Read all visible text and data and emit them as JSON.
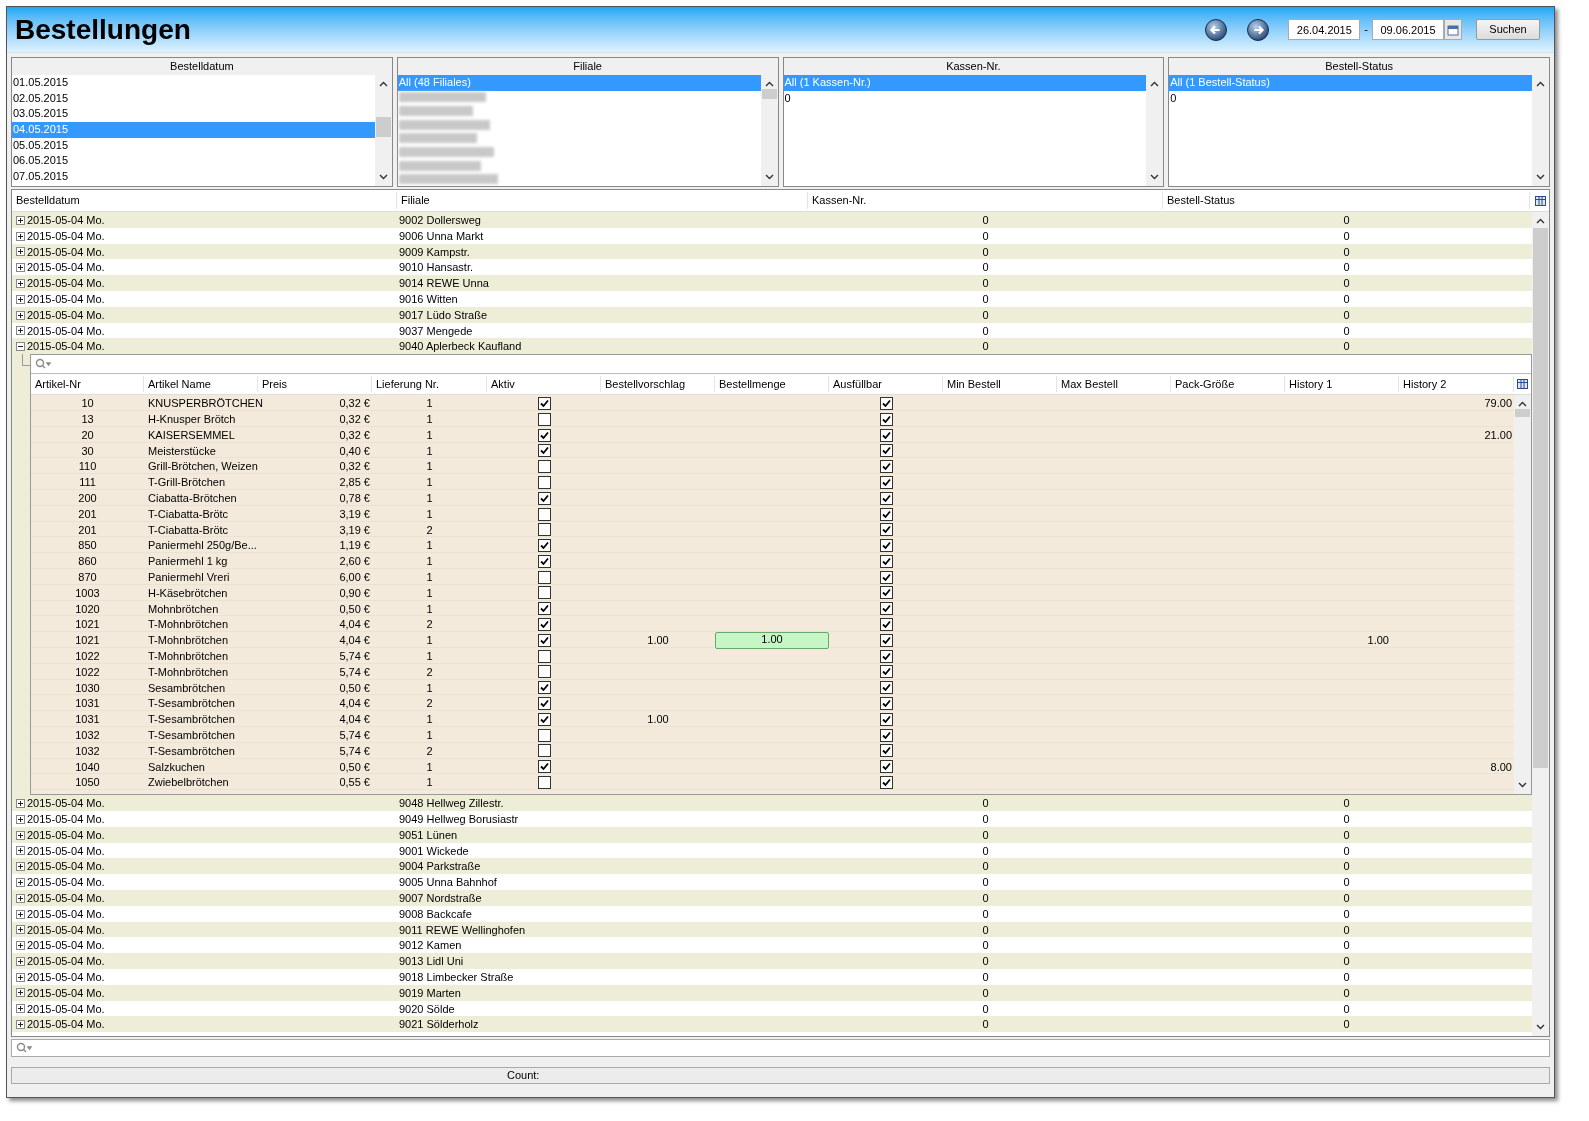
{
  "window": {
    "title": "Bestellungen"
  },
  "toolbar": {
    "date_from": "26.04.2015",
    "separator": "-",
    "date_to": "09.06.2015",
    "search_button": "Suchen"
  },
  "filters": [
    {
      "title": "Bestelldatum",
      "items": [
        {
          "kind": "text",
          "label": "01.05.2015",
          "selected": false
        },
        {
          "kind": "text",
          "label": "02.05.2015",
          "selected": false
        },
        {
          "kind": "text",
          "label": "03.05.2015",
          "selected": false
        },
        {
          "kind": "text",
          "label": "04.05.2015",
          "selected": true
        },
        {
          "kind": "text",
          "label": "05.05.2015",
          "selected": false
        },
        {
          "kind": "text",
          "label": "06.05.2015",
          "selected": false
        },
        {
          "kind": "text",
          "label": "07.05.2015",
          "selected": false
        }
      ]
    },
    {
      "title": "Filiale",
      "items": [
        {
          "kind": "text",
          "label": "All (48 Filiales)",
          "selected": true
        },
        {
          "kind": "blurred",
          "selected": false
        },
        {
          "kind": "blurred",
          "selected": false
        },
        {
          "kind": "blurred",
          "selected": false
        },
        {
          "kind": "blurred",
          "selected": false
        },
        {
          "kind": "blurred",
          "selected": false
        },
        {
          "kind": "blurred",
          "selected": false
        },
        {
          "kind": "blurred",
          "selected": false
        }
      ]
    },
    {
      "title": "Kassen-Nr.",
      "items": [
        {
          "kind": "text",
          "label": "All (1 Kassen-Nr.)",
          "selected": true
        },
        {
          "kind": "text",
          "label": "0",
          "selected": false
        }
      ]
    },
    {
      "title": "Bestell-Status",
      "items": [
        {
          "kind": "text",
          "label": "All (1 Bestell-Status)",
          "selected": true
        },
        {
          "kind": "text",
          "label": "0",
          "selected": false
        }
      ]
    }
  ],
  "grid": {
    "columns": [
      "Bestelldatum",
      "Filiale",
      "Kassen-Nr.",
      "Bestell-Status"
    ],
    "rows_before": [
      {
        "date": "2015-05-04 Mo.",
        "filiale": "9002 Dollersweg",
        "kasse": "0",
        "status": "0",
        "expanded": false
      },
      {
        "date": "2015-05-04 Mo.",
        "filiale": "9006 Unna Markt",
        "kasse": "0",
        "status": "0",
        "expanded": false
      },
      {
        "date": "2015-05-04 Mo.",
        "filiale": "9009 Kampstr.",
        "kasse": "0",
        "status": "0",
        "expanded": false
      },
      {
        "date": "2015-05-04 Mo.",
        "filiale": "9010 Hansastr.",
        "kasse": "0",
        "status": "0",
        "expanded": false
      },
      {
        "date": "2015-05-04 Mo.",
        "filiale": "9014 REWE Unna",
        "kasse": "0",
        "status": "0",
        "expanded": false
      },
      {
        "date": "2015-05-04 Mo.",
        "filiale": "9016 Witten",
        "kasse": "0",
        "status": "0",
        "expanded": false
      },
      {
        "date": "2015-05-04 Mo.",
        "filiale": "9017 Lüdo Straße",
        "kasse": "0",
        "status": "0",
        "expanded": false
      },
      {
        "date": "2015-05-04 Mo.",
        "filiale": "9037 Mengede",
        "kasse": "0",
        "status": "0",
        "expanded": false
      },
      {
        "date": "2015-05-04 Mo.",
        "filiale": "9040 Aplerbeck Kaufland",
        "kasse": "0",
        "status": "0",
        "expanded": true
      }
    ],
    "detail": {
      "columns": [
        "Artikel-Nr",
        "Artikel Name",
        "Preis",
        "Lieferung Nr.",
        "Aktiv",
        "Bestellvorschlag",
        "Bestellmenge",
        "Ausfüllbar",
        "Min Bestell",
        "Max Bestell",
        "Pack-Größe",
        "History 1",
        "History 2"
      ],
      "rows": [
        {
          "nr": "10",
          "name": "KNUSPERBRÖTCHEN",
          "preis": "0,32 €",
          "lieferung": "1",
          "aktiv": true,
          "vorschlag": "",
          "menge": "",
          "editing": false,
          "ausfuellbar": true,
          "history1": "",
          "history2": "79.00"
        },
        {
          "nr": "13",
          "name": "H-Knusper Brötch",
          "preis": "0,32 €",
          "lieferung": "1",
          "aktiv": false,
          "vorschlag": "",
          "menge": "",
          "editing": false,
          "ausfuellbar": true,
          "history1": "",
          "history2": ""
        },
        {
          "nr": "20",
          "name": "KAISERSEMMEL",
          "preis": "0,32 €",
          "lieferung": "1",
          "aktiv": true,
          "vorschlag": "",
          "menge": "",
          "editing": false,
          "ausfuellbar": true,
          "history1": "",
          "history2": "21.00"
        },
        {
          "nr": "30",
          "name": "Meisterstücke",
          "preis": "0,40 €",
          "lieferung": "1",
          "aktiv": true,
          "vorschlag": "",
          "menge": "",
          "editing": false,
          "ausfuellbar": true,
          "history1": "",
          "history2": ""
        },
        {
          "nr": "110",
          "name": "Grill-Brötchen, Weizen",
          "preis": "0,32 €",
          "lieferung": "1",
          "aktiv": false,
          "vorschlag": "",
          "menge": "",
          "editing": false,
          "ausfuellbar": true,
          "history1": "",
          "history2": ""
        },
        {
          "nr": "111",
          "name": "T-Grill-Brötchen",
          "preis": "2,85 €",
          "lieferung": "1",
          "aktiv": false,
          "vorschlag": "",
          "menge": "",
          "editing": false,
          "ausfuellbar": true,
          "history1": "",
          "history2": ""
        },
        {
          "nr": "200",
          "name": "Ciabatta-Brötchen",
          "preis": "0,78 €",
          "lieferung": "1",
          "aktiv": true,
          "vorschlag": "",
          "menge": "",
          "editing": false,
          "ausfuellbar": true,
          "history1": "",
          "history2": ""
        },
        {
          "nr": "201",
          "name": "T-Ciabatta-Brötc",
          "preis": "3,19 €",
          "lieferung": "1",
          "aktiv": false,
          "vorschlag": "",
          "menge": "",
          "editing": false,
          "ausfuellbar": true,
          "history1": "",
          "history2": ""
        },
        {
          "nr": "201",
          "name": "T-Ciabatta-Brötc",
          "preis": "3,19 €",
          "lieferung": "2",
          "aktiv": false,
          "vorschlag": "",
          "menge": "",
          "editing": false,
          "ausfuellbar": true,
          "history1": "",
          "history2": ""
        },
        {
          "nr": "850",
          "name": "Paniermehl 250g/Be...",
          "preis": "1,19 €",
          "lieferung": "1",
          "aktiv": true,
          "vorschlag": "",
          "menge": "",
          "editing": false,
          "ausfuellbar": true,
          "history1": "",
          "history2": ""
        },
        {
          "nr": "860",
          "name": "Paniermehl 1 kg",
          "preis": "2,60 €",
          "lieferung": "1",
          "aktiv": true,
          "vorschlag": "",
          "menge": "",
          "editing": false,
          "ausfuellbar": true,
          "history1": "",
          "history2": ""
        },
        {
          "nr": "870",
          "name": "Paniermehl Vreri",
          "preis": "6,00 €",
          "lieferung": "1",
          "aktiv": false,
          "vorschlag": "",
          "menge": "",
          "editing": false,
          "ausfuellbar": true,
          "history1": "",
          "history2": ""
        },
        {
          "nr": "1003",
          "name": "H-Käsebrötchen",
          "preis": "0,90 €",
          "lieferung": "1",
          "aktiv": false,
          "vorschlag": "",
          "menge": "",
          "editing": false,
          "ausfuellbar": true,
          "history1": "",
          "history2": ""
        },
        {
          "nr": "1020",
          "name": "Mohnbrötchen",
          "preis": "0,50 €",
          "lieferung": "1",
          "aktiv": true,
          "vorschlag": "",
          "menge": "",
          "editing": false,
          "ausfuellbar": true,
          "history1": "",
          "history2": ""
        },
        {
          "nr": "1021",
          "name": "T-Mohnbrötchen",
          "preis": "4,04 €",
          "lieferung": "2",
          "aktiv": true,
          "vorschlag": "",
          "menge": "",
          "editing": false,
          "ausfuellbar": true,
          "history1": "",
          "history2": ""
        },
        {
          "nr": "1021",
          "name": "T-Mohnbrötchen",
          "preis": "4,04 €",
          "lieferung": "1",
          "aktiv": true,
          "vorschlag": "1.00",
          "menge": "1.00",
          "editing": true,
          "ausfuellbar": true,
          "history1": "1.00",
          "history2": ""
        },
        {
          "nr": "1022",
          "name": "T-Mohnbrötchen",
          "preis": "5,74 €",
          "lieferung": "1",
          "aktiv": false,
          "vorschlag": "",
          "menge": "",
          "editing": false,
          "ausfuellbar": true,
          "history1": "",
          "history2": ""
        },
        {
          "nr": "1022",
          "name": "T-Mohnbrötchen",
          "preis": "5,74 €",
          "lieferung": "2",
          "aktiv": false,
          "vorschlag": "",
          "menge": "",
          "editing": false,
          "ausfuellbar": true,
          "history1": "",
          "history2": ""
        },
        {
          "nr": "1030",
          "name": "Sesambrötchen",
          "preis": "0,50 €",
          "lieferung": "1",
          "aktiv": true,
          "vorschlag": "",
          "menge": "",
          "editing": false,
          "ausfuellbar": true,
          "history1": "",
          "history2": ""
        },
        {
          "nr": "1031",
          "name": "T-Sesambrötchen",
          "preis": "4,04 €",
          "lieferung": "2",
          "aktiv": true,
          "vorschlag": "",
          "menge": "",
          "editing": false,
          "ausfuellbar": true,
          "history1": "",
          "history2": ""
        },
        {
          "nr": "1031",
          "name": "T-Sesambrötchen",
          "preis": "4,04 €",
          "lieferung": "1",
          "aktiv": true,
          "vorschlag": "1.00",
          "menge": "",
          "editing": false,
          "ausfuellbar": true,
          "history1": "",
          "history2": ""
        },
        {
          "nr": "1032",
          "name": "T-Sesambrötchen",
          "preis": "5,74 €",
          "lieferung": "1",
          "aktiv": false,
          "vorschlag": "",
          "menge": "",
          "editing": false,
          "ausfuellbar": true,
          "history1": "",
          "history2": ""
        },
        {
          "nr": "1032",
          "name": "T-Sesambrötchen",
          "preis": "5,74 €",
          "lieferung": "2",
          "aktiv": false,
          "vorschlag": "",
          "menge": "",
          "editing": false,
          "ausfuellbar": true,
          "history1": "",
          "history2": ""
        },
        {
          "nr": "1040",
          "name": "Salzkuchen",
          "preis": "0,50 €",
          "lieferung": "1",
          "aktiv": true,
          "vorschlag": "",
          "menge": "",
          "editing": false,
          "ausfuellbar": true,
          "history1": "",
          "history2": "8.00"
        },
        {
          "nr": "1050",
          "name": "Zwiebelbrötchen",
          "preis": "0,55 €",
          "lieferung": "1",
          "aktiv": false,
          "vorschlag": "",
          "menge": "",
          "editing": false,
          "ausfuellbar": true,
          "history1": "",
          "history2": ""
        }
      ]
    },
    "rows_after": [
      {
        "date": "2015-05-04 Mo.",
        "filiale": "9048 Hellweg Zillestr.",
        "kasse": "0",
        "status": "0",
        "expanded": false
      },
      {
        "date": "2015-05-04 Mo.",
        "filiale": "9049 Hellweg Borusiastr",
        "kasse": "0",
        "status": "0",
        "expanded": false
      },
      {
        "date": "2015-05-04 Mo.",
        "filiale": "9051 Lünen",
        "kasse": "0",
        "status": "0",
        "expanded": false
      },
      {
        "date": "2015-05-04 Mo.",
        "filiale": "9001 Wickede",
        "kasse": "0",
        "status": "0",
        "expanded": false
      },
      {
        "date": "2015-05-04 Mo.",
        "filiale": "9004 Parkstraße",
        "kasse": "0",
        "status": "0",
        "expanded": false
      },
      {
        "date": "2015-05-04 Mo.",
        "filiale": "9005 Unna Bahnhof",
        "kasse": "0",
        "status": "0",
        "expanded": false
      },
      {
        "date": "2015-05-04 Mo.",
        "filiale": "9007 Nordstraße",
        "kasse": "0",
        "status": "0",
        "expanded": false
      },
      {
        "date": "2015-05-04 Mo.",
        "filiale": "9008 Backcafe",
        "kasse": "0",
        "status": "0",
        "expanded": false
      },
      {
        "date": "2015-05-04 Mo.",
        "filiale": "9011 REWE Wellinghofen",
        "kasse": "0",
        "status": "0",
        "expanded": false
      },
      {
        "date": "2015-05-04 Mo.",
        "filiale": "9012 Kamen",
        "kasse": "0",
        "status": "0",
        "expanded": false
      },
      {
        "date": "2015-05-04 Mo.",
        "filiale": "9013 Lidl Uni",
        "kasse": "0",
        "status": "0",
        "expanded": false
      },
      {
        "date": "2015-05-04 Mo.",
        "filiale": "9018 Limbecker Straße",
        "kasse": "0",
        "status": "0",
        "expanded": false
      },
      {
        "date": "2015-05-04 Mo.",
        "filiale": "9019 Marten",
        "kasse": "0",
        "status": "0",
        "expanded": false
      },
      {
        "date": "2015-05-04 Mo.",
        "filiale": "9020 Sölde",
        "kasse": "0",
        "status": "0",
        "expanded": false
      },
      {
        "date": "2015-05-04 Mo.",
        "filiale": "9021 Sölderholz",
        "kasse": "0",
        "status": "0",
        "expanded": false
      }
    ]
  },
  "status_bar": {
    "label": "Count:"
  }
}
